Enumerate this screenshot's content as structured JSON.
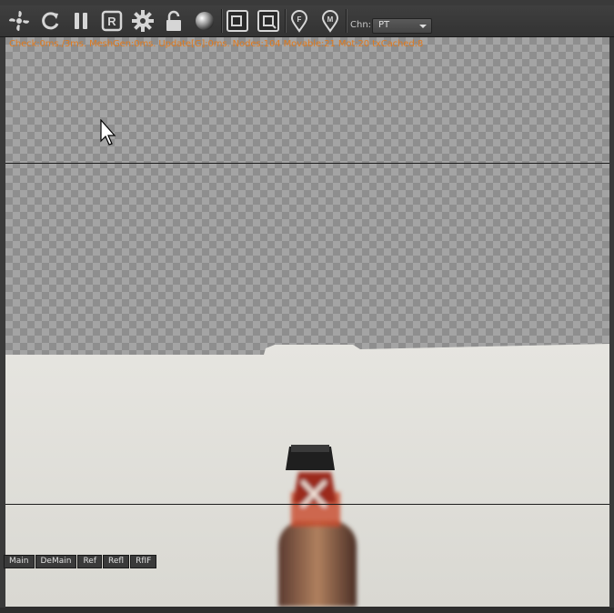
{
  "toolbar": {
    "buttons": [
      {
        "icon": "fan-icon",
        "title": "Reset camera"
      },
      {
        "icon": "refresh-icon",
        "title": "Restart render"
      },
      {
        "icon": "pause-icon",
        "title": "Pause"
      },
      {
        "icon": "r-icon",
        "label": "R"
      },
      {
        "icon": "gear-icon",
        "title": "Settings"
      },
      {
        "icon": "lock-icon",
        "title": "Lock"
      },
      {
        "icon": "sphere-icon",
        "title": "Preview sphere"
      },
      {
        "icon": "region-icon",
        "title": "Region"
      },
      {
        "icon": "film-region-icon",
        "title": "Film region"
      },
      {
        "icon": "pin-f-icon",
        "label": "F"
      },
      {
        "icon": "pin-m-icon",
        "label": "M"
      }
    ],
    "channel_label": "Chn:",
    "channel_value": "PT"
  },
  "stats": "Check:0ms./3ms. MeshGen:0ms. Update[G]:0ms. Nodes:104 Movable:21 Mot:20 txCached:8",
  "view_tabs": [
    "Main",
    "DeMain",
    "Ref",
    "Refl",
    "RfIF"
  ],
  "colors": {
    "stats_text": "#e07a1e",
    "toolbar_bg": "#3a3a3a",
    "checker_dark": "#8e8e8e",
    "checker_light": "#a4a4a4",
    "floor": "#e4e3de"
  }
}
